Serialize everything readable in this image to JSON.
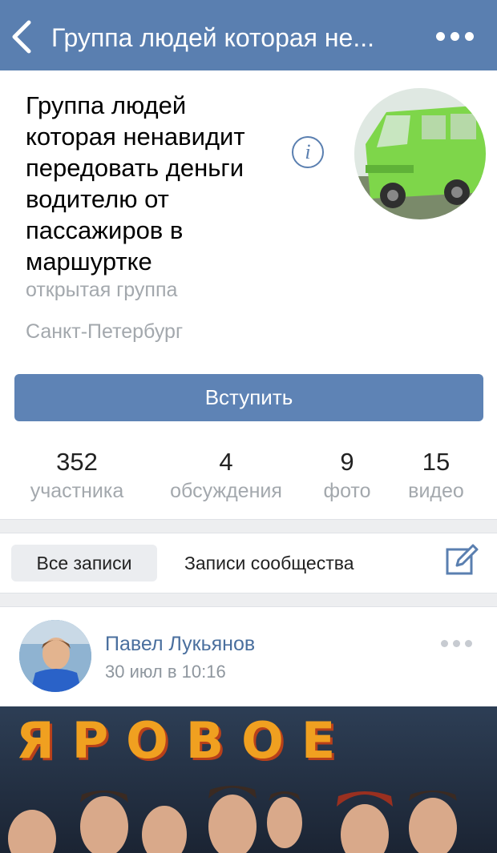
{
  "navbar": {
    "title": "Группа людей которая не...",
    "back_icon": "chevron-left-icon",
    "more_icon": "more-dots-icon"
  },
  "group": {
    "name": "Группа людей которая ненавидит передовать деньги водителю от пассажиров в маршуртке",
    "type": "открытая группа",
    "city": "Санкт-Петербург",
    "info_icon_label": "i",
    "join_label": "Вступить"
  },
  "counters": [
    {
      "value": "352",
      "label": "участника"
    },
    {
      "value": "4",
      "label": "обсуждения"
    },
    {
      "value": "9",
      "label": "фото"
    },
    {
      "value": "15",
      "label": "видео"
    }
  ],
  "tabs": {
    "all_posts": "Все записи",
    "community_posts": "Записи сообщества"
  },
  "post": {
    "author": "Павел Лукьянов",
    "date": "30 июл в 10:16",
    "image_text": "ЯРОВОЕ"
  },
  "colors": {
    "nav_bg": "#5a7fb0",
    "join_bg": "#5e83b5",
    "link": "#4a6f9e",
    "muted": "#a3a8ad"
  }
}
